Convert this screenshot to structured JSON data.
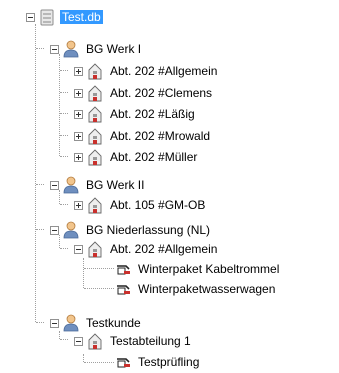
{
  "tree": {
    "root": {
      "label": "Test.db",
      "icon": "database-icon",
      "state": "expanded",
      "selected": true
    },
    "groups": [
      {
        "label": "BG Werk I",
        "icon": "user-icon",
        "state": "expanded",
        "children": [
          {
            "label": "Abt. 202 #Allgemein",
            "icon": "department-icon",
            "state": "collapsed"
          },
          {
            "label": "Abt. 202 #Clemens",
            "icon": "department-icon",
            "state": "collapsed"
          },
          {
            "label": "Abt. 202 #Läßig",
            "icon": "department-icon",
            "state": "collapsed"
          },
          {
            "label": "Abt. 202 #Mrowald",
            "icon": "department-icon",
            "state": "collapsed"
          },
          {
            "label": "Abt. 202 #Müller",
            "icon": "department-icon",
            "state": "collapsed"
          }
        ]
      },
      {
        "label": "BG Werk II",
        "icon": "user-icon",
        "state": "expanded",
        "children": [
          {
            "label": "Abt. 105 #GM-OB",
            "icon": "department-icon",
            "state": "collapsed"
          }
        ]
      },
      {
        "label": "BG Niederlassung (NL)",
        "icon": "user-icon",
        "state": "expanded",
        "children": [
          {
            "label": "Abt. 202 #Allgemein",
            "icon": "department-icon",
            "state": "expanded",
            "children": [
              {
                "label": "Winterpaket Kabeltrommel",
                "icon": "device-icon"
              },
              {
                "label": "Winterpaketwasserwagen",
                "icon": "device-icon"
              }
            ]
          }
        ]
      },
      {
        "label": "Testkunde",
        "icon": "user-icon",
        "state": "expanded",
        "children": [
          {
            "label": "Testabteilung 1",
            "icon": "department-icon",
            "state": "expanded",
            "children": [
              {
                "label": "Testprüfling",
                "icon": "device-icon"
              }
            ]
          }
        ]
      }
    ]
  }
}
